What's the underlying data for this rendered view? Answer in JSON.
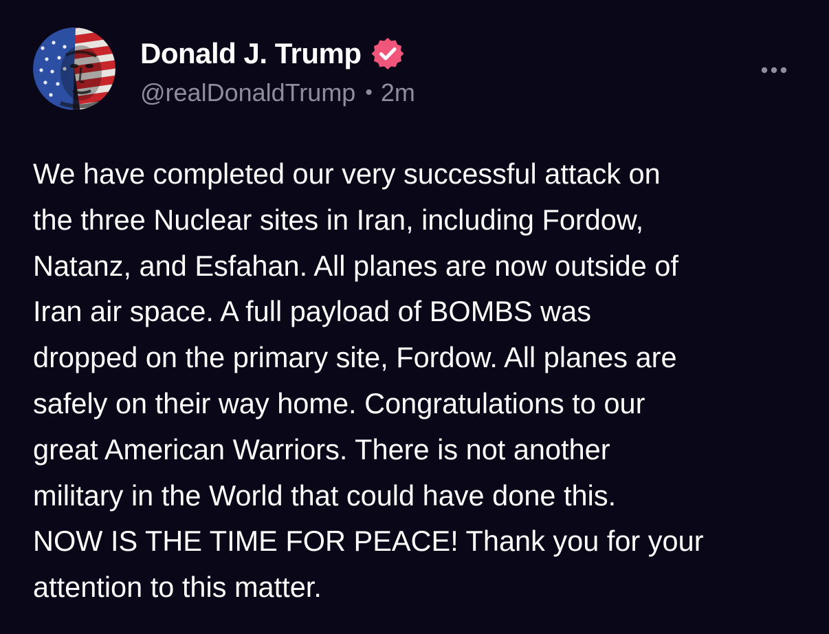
{
  "author": {
    "display_name": "Donald J. Trump",
    "handle": "@realDonaldTrump",
    "separator": "•",
    "timestamp": "2m",
    "verified_icon": "verified-badge-icon",
    "verified_color": "#f0567a",
    "avatar_alt": "flag-painted-portrait"
  },
  "post": {
    "lines": [
      "We have completed our very successful attack on",
      "the three Nuclear sites in Iran, including Fordow,",
      "Natanz, and Esfahan. All planes are now outside of",
      "Iran air space. A full payload of BOMBS was",
      "dropped on the primary site, Fordow. All planes are",
      "safely on their way home. Congratulations to our",
      "great American Warriors. There is not another",
      "military in the World that could have done this.",
      "NOW IS THE TIME FOR PEACE! Thank you for your",
      "attention to this matter."
    ]
  },
  "menu": {
    "icon": "more-horizontal-icon"
  },
  "colors": {
    "background": "#0a0719",
    "text": "#ffffff",
    "secondary_text": "#8f8d9d"
  }
}
